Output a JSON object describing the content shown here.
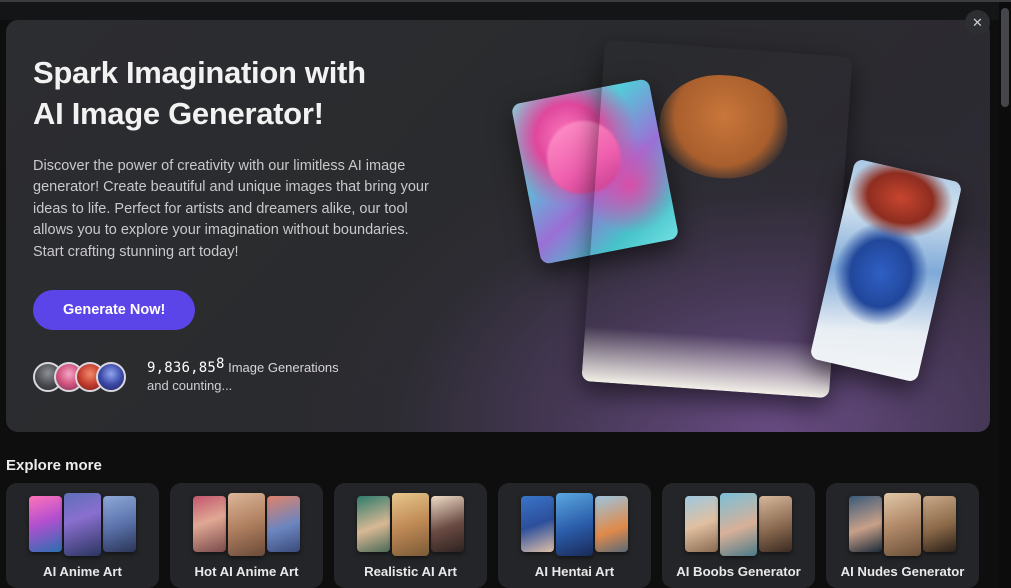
{
  "hero": {
    "headline_line1": "Spark Imagination with",
    "headline_line2": "AI Image Generator!",
    "subcopy": "Discover the power of creativity with our limitless AI image generator! Create beautiful and unique images that bring your ideas to life. Perfect for artists and dreamers alike, our tool allows you to explore your imagination without boundaries. Start crafting stunning art today!",
    "cta_label": "Generate Now!",
    "counter_value": "9,836,85",
    "counter_rolling_digit": "8",
    "counter_label": "Image Generations",
    "counter_sublabel": "and counting...",
    "accent_color": "#5b45e8",
    "panel_color": "#2c2d30",
    "glow_color": "#7e58a0"
  },
  "close_button": {
    "icon": "close-icon",
    "glyph": "✕"
  },
  "scrollbar": {
    "thumb_color": "#45464b"
  },
  "explore": {
    "title": "Explore more",
    "cards": [
      {
        "label": "AI Anime Art"
      },
      {
        "label": "Hot AI Anime Art"
      },
      {
        "label": "Realistic AI Art"
      },
      {
        "label": "AI Hentai Art"
      },
      {
        "label": "AI Boobs Generator"
      },
      {
        "label": "AI Nudes Generator"
      }
    ]
  }
}
